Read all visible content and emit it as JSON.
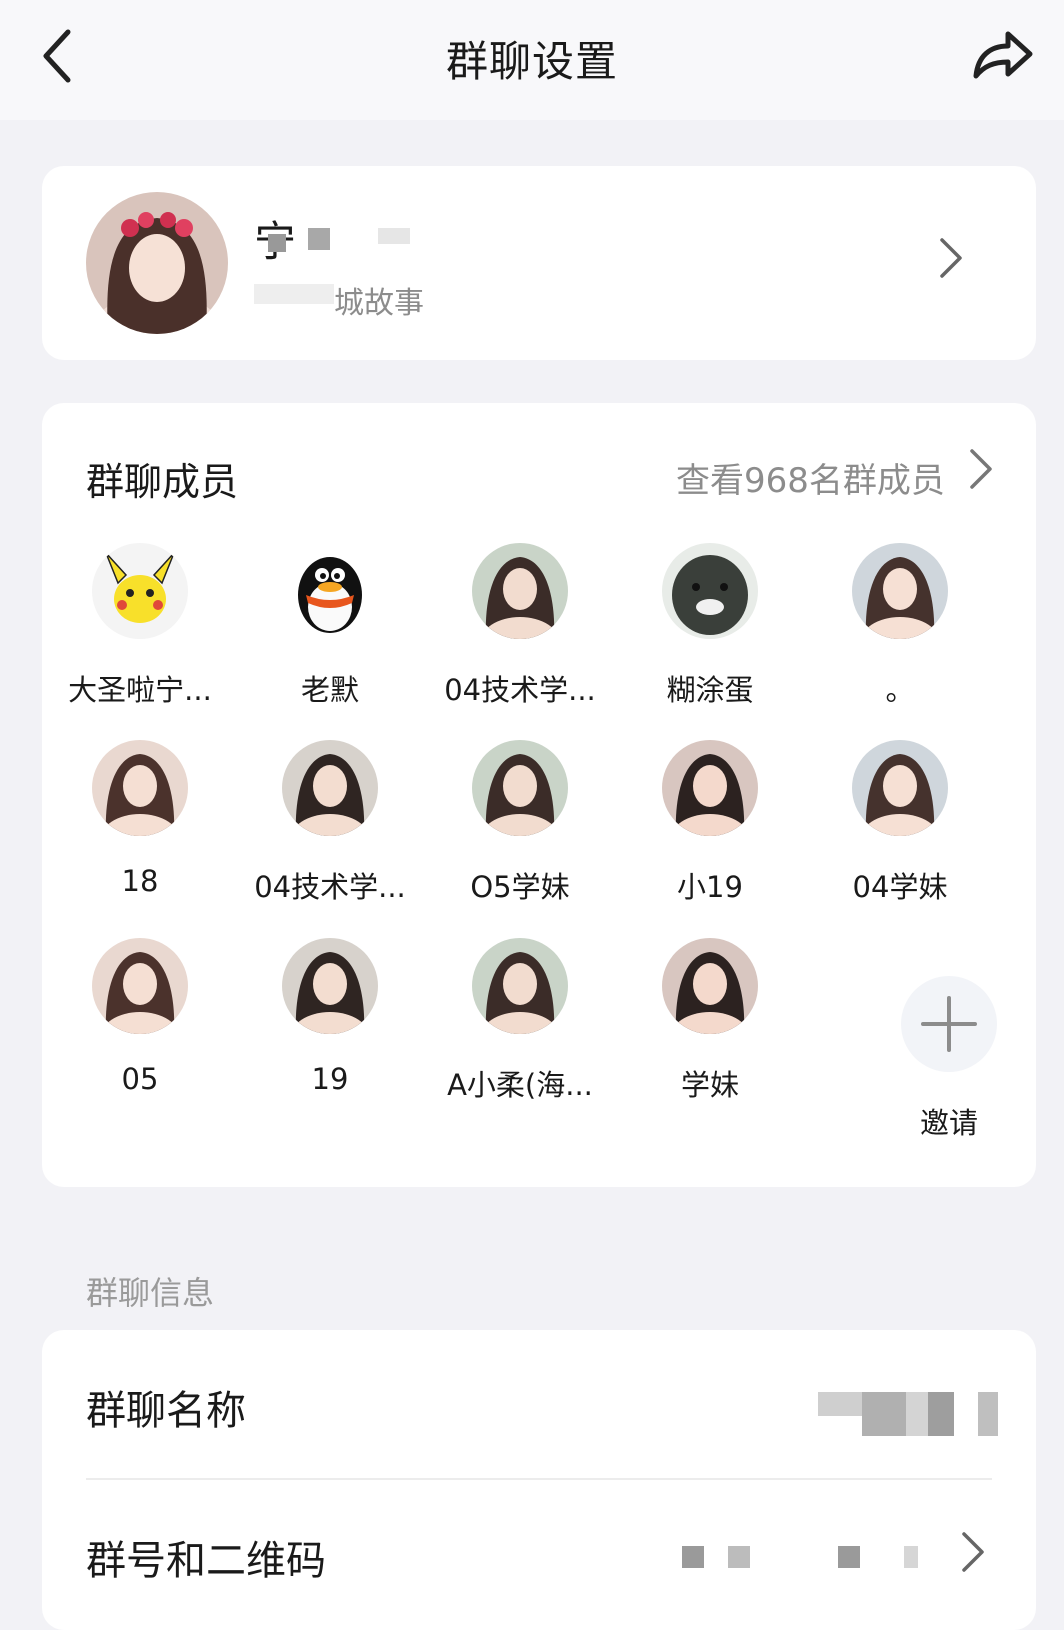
{
  "header": {
    "title": "群聊设置",
    "back_icon": "chevron-left-icon",
    "share_icon": "share-arrow-icon"
  },
  "group": {
    "name": "宁",
    "subtitle": "城故事"
  },
  "members_section": {
    "title": "群聊成员",
    "view_all": "查看968名群成员",
    "members": [
      {
        "name": "大圣啦宁...",
        "avatar": "pikachu"
      },
      {
        "name": "老默",
        "avatar": "penguin"
      },
      {
        "name": "04技术学...",
        "avatar": "photo"
      },
      {
        "name": "糊涂蛋",
        "avatar": "dark-creature"
      },
      {
        "name": "。",
        "avatar": "photo"
      },
      {
        "name": "18",
        "avatar": "photo"
      },
      {
        "name": "04技术学...",
        "avatar": "photo"
      },
      {
        "name": "O5学妹",
        "avatar": "photo"
      },
      {
        "name": "小19",
        "avatar": "photo"
      },
      {
        "name": "04学妹",
        "avatar": "photo"
      },
      {
        "name": "05",
        "avatar": "photo"
      },
      {
        "name": "19",
        "avatar": "photo"
      },
      {
        "name": "A小柔(海...",
        "avatar": "photo"
      },
      {
        "name": "学妹",
        "avatar": "photo"
      }
    ],
    "invite_label": "邀请"
  },
  "info_section": {
    "label": "群聊信息",
    "rows": [
      {
        "label": "群聊名称"
      },
      {
        "label": "群号和二维码"
      }
    ]
  },
  "colors": {
    "background": "#f2f2f6",
    "card": "#ffffff",
    "secondary_text": "#8c8c8c"
  }
}
